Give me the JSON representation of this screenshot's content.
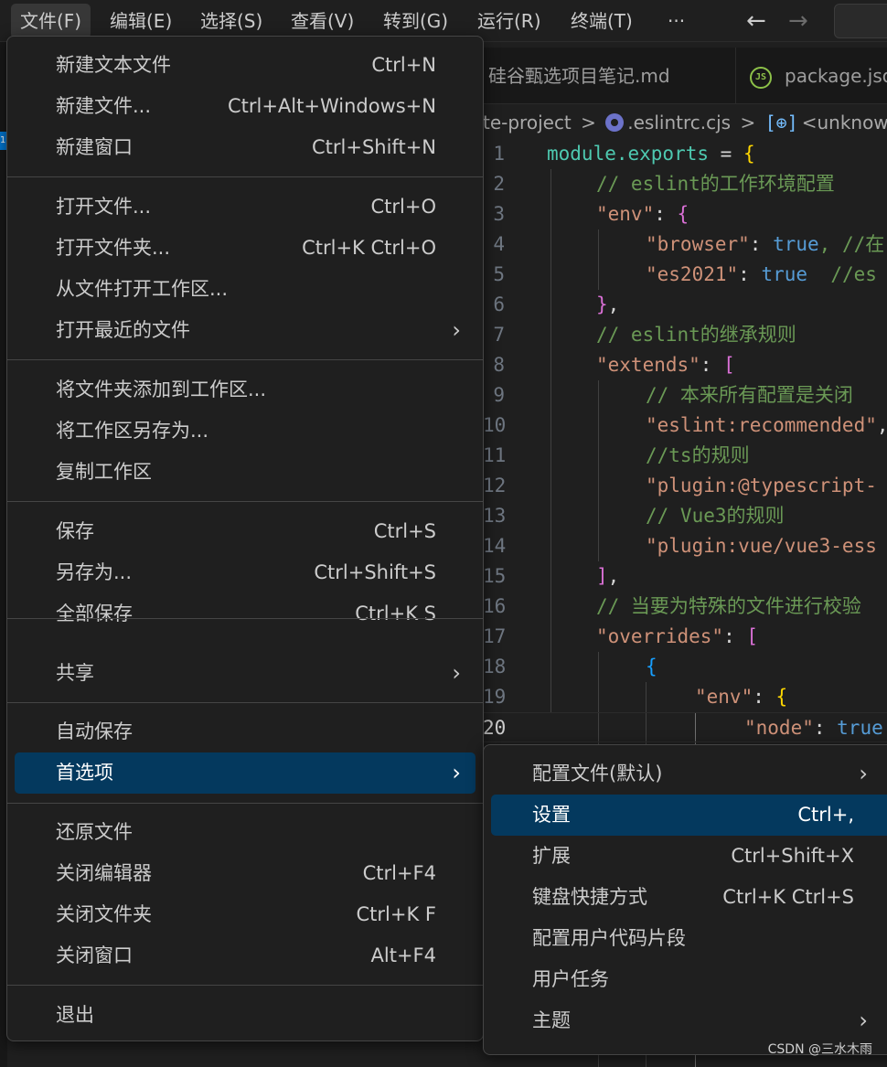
{
  "menubar": {
    "items": [
      "文件(F)",
      "编辑(E)",
      "选择(S)",
      "查看(V)",
      "转到(G)",
      "运行(R)",
      "终端(T)",
      "···"
    ],
    "back_icon": "←",
    "forward_icon": "→"
  },
  "activity": {
    "badge": "1"
  },
  "tabs": {
    "md_tab": "硅谷甄选项目笔记.md",
    "pkg_tab": "package.json",
    "js_icon": "JS"
  },
  "breadcrumb": {
    "folder": "te-project",
    "sep": ">",
    "file": ".eslintrc.cjs",
    "symbol_icon": "[⊕]",
    "symbol": "<unknown>"
  },
  "editor": {
    "lines": [
      {
        "n": "1"
      },
      {
        "n": "2"
      },
      {
        "n": "3"
      },
      {
        "n": "4"
      },
      {
        "n": "5"
      },
      {
        "n": "6"
      },
      {
        "n": "7"
      },
      {
        "n": "8"
      },
      {
        "n": "9"
      },
      {
        "n": "10"
      },
      {
        "n": "11"
      },
      {
        "n": "12"
      },
      {
        "n": "13"
      },
      {
        "n": "14"
      },
      {
        "n": "15"
      },
      {
        "n": "16"
      },
      {
        "n": "17"
      },
      {
        "n": "18"
      },
      {
        "n": "19"
      },
      {
        "n": "20"
      }
    ],
    "code": {
      "l1a": "module.exports",
      "l1b": " = ",
      "l1c": "{",
      "l2": "// eslint的工作环境配置",
      "l3a": "\"env\"",
      "l3b": ": ",
      "l3c": "{",
      "l4a": "\"browser\"",
      "l4b": ": ",
      "l4c": "true",
      "l4d": ", //在",
      "l5a": "\"es2021\"",
      "l5b": ": ",
      "l5c": "true",
      "l5d": "  //es",
      "l6a": "}",
      "l6b": ",",
      "l7": "// eslint的继承规则",
      "l8a": "\"extends\"",
      "l8b": ": ",
      "l8c": "[",
      "l9": "// 本来所有配置是关闭",
      "l10a": "\"eslint:recommended\"",
      "l10b": ",",
      "l11": "//ts的规则",
      "l12": "\"plugin:@typescript-",
      "l13": "// Vue3的规则",
      "l14": "\"plugin:vue/vue3-ess",
      "l15a": "]",
      "l15b": ",",
      "l16": "// 当要为特殊的文件进行校验",
      "l17a": "\"overrides\"",
      "l17b": ": ",
      "l17c": "[",
      "l18": "{",
      "l19a": "\"env\"",
      "l19b": ": ",
      "l19c": "{",
      "l20a": "\"node\"",
      "l20b": ": ",
      "l20c": "true"
    }
  },
  "file_menu": {
    "new_text_file": {
      "label": "新建文本文件",
      "shortcut": "Ctrl+N"
    },
    "new_file": {
      "label": "新建文件...",
      "shortcut": "Ctrl+Alt+Windows+N"
    },
    "new_window": {
      "label": "新建窗口",
      "shortcut": "Ctrl+Shift+N"
    },
    "open_file": {
      "label": "打开文件...",
      "shortcut": "Ctrl+O"
    },
    "open_folder": {
      "label": "打开文件夹...",
      "shortcut": "Ctrl+K Ctrl+O"
    },
    "open_workspace": {
      "label": "从文件打开工作区..."
    },
    "open_recent": {
      "label": "打开最近的文件"
    },
    "add_folder": {
      "label": "将文件夹添加到工作区..."
    },
    "save_workspace_as": {
      "label": "将工作区另存为..."
    },
    "duplicate_workspace": {
      "label": "复制工作区"
    },
    "save": {
      "label": "保存",
      "shortcut": "Ctrl+S"
    },
    "save_as": {
      "label": "另存为...",
      "shortcut": "Ctrl+Shift+S"
    },
    "save_all": {
      "label": "全部保存",
      "shortcut": "Ctrl+K S"
    },
    "share": {
      "label": "共享"
    },
    "auto_save": {
      "label": "自动保存"
    },
    "preferences": {
      "label": "首选项"
    },
    "revert_file": {
      "label": "还原文件"
    },
    "close_editor": {
      "label": "关闭编辑器",
      "shortcut": "Ctrl+F4"
    },
    "close_folder": {
      "label": "关闭文件夹",
      "shortcut": "Ctrl+K F"
    },
    "close_window": {
      "label": "关闭窗口",
      "shortcut": "Alt+F4"
    },
    "exit": {
      "label": "退出"
    },
    "chevron": "›"
  },
  "pref_menu": {
    "profile": {
      "label": "配置文件(默认)"
    },
    "settings": {
      "label": "设置",
      "shortcut": "Ctrl+,"
    },
    "extensions": {
      "label": "扩展",
      "shortcut": "Ctrl+Shift+X"
    },
    "keybindings": {
      "label": "键盘快捷方式",
      "shortcut": "Ctrl+K Ctrl+S"
    },
    "snippets": {
      "label": "配置用户代码片段"
    },
    "tasks": {
      "label": "用户任务"
    },
    "themes": {
      "label": "主题"
    }
  },
  "watermark": "CSDN @三水木雨",
  "colors": {
    "selection": "#04395e",
    "menu_bg": "#1f1f1f",
    "border": "#454545"
  }
}
